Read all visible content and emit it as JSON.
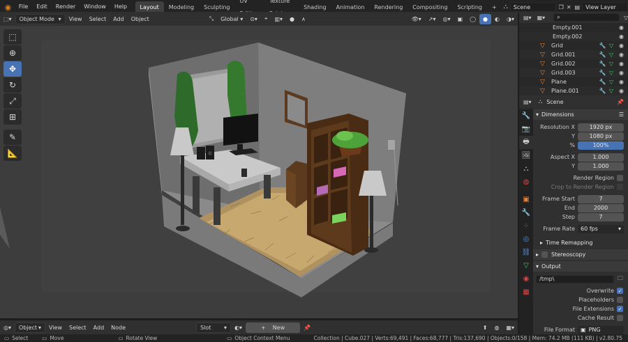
{
  "topbar": {
    "menus": [
      "File",
      "Edit",
      "Render",
      "Window",
      "Help"
    ],
    "workspaces": [
      "Layout",
      "Modeling",
      "Sculpting",
      "UV Editing",
      "Texture Paint",
      "Shading",
      "Animation",
      "Rendering",
      "Compositing",
      "Scripting"
    ],
    "active_workspace": "Layout",
    "scene": "Scene",
    "view_layer": "View Layer"
  },
  "viewport_header": {
    "mode": "Object Mode",
    "menus": [
      "View",
      "Select",
      "Add",
      "Object"
    ],
    "transform_orientation": "Global"
  },
  "outliner": {
    "items": [
      {
        "name": "Empty.001",
        "type": "empty"
      },
      {
        "name": "Empty.002",
        "type": "empty"
      },
      {
        "name": "Grid",
        "type": "mesh"
      },
      {
        "name": "Grid.001",
        "type": "mesh"
      },
      {
        "name": "Grid.002",
        "type": "mesh"
      },
      {
        "name": "Grid.003",
        "type": "mesh"
      },
      {
        "name": "Plane",
        "type": "mesh"
      },
      {
        "name": "Plane.001",
        "type": "mesh"
      }
    ]
  },
  "properties": {
    "context": "Scene",
    "dimensions_title": "Dimensions",
    "resolution_x_label": "Resolution X",
    "resolution_x": "1920 px",
    "resolution_y_label": "Y",
    "resolution_y": "1080 px",
    "percent_label": "%",
    "percent": "100%",
    "aspect_x_label": "Aspect X",
    "aspect_x": "1.000",
    "aspect_y_label": "Y",
    "aspect_y": "1.000",
    "render_region": "Render Region",
    "crop_region": "Crop to Render Region",
    "frame_start_label": "Frame Start",
    "frame_start": "7",
    "frame_end_label": "End",
    "frame_end": "2000",
    "frame_step_label": "Step",
    "frame_step": "7",
    "frame_rate_label": "Frame Rate",
    "frame_rate": "60 fps",
    "time_remapping": "Time Remapping",
    "stereoscopy": "Stereoscopy",
    "output_title": "Output",
    "output_path": "/tmp\\",
    "overwrite": "Overwrite",
    "placeholders": "Placeholders",
    "file_extensions": "File Extensions",
    "cache_result": "Cache Result",
    "file_format_label": "File Format",
    "file_format": "PNG"
  },
  "node_header": {
    "type": "Object",
    "menus": [
      "View",
      "Select",
      "Add",
      "Node"
    ],
    "slot": "Slot",
    "new_label": "New"
  },
  "statusbar": {
    "select": "Select",
    "move": "Move",
    "rotate_view": "Rotate View",
    "context_menu": "Object Context Menu",
    "stats": "Collection | Cube.027 | Verts:69,491 | Faces:68,777 | Tris:137,690 | Objects:0/158 | Mem: 74.2 MB (111 KB) | v2.80.75"
  },
  "colors": {
    "accent": "#4772b3",
    "mesh_icon": "#e8853d",
    "active_tab": "#404040"
  }
}
